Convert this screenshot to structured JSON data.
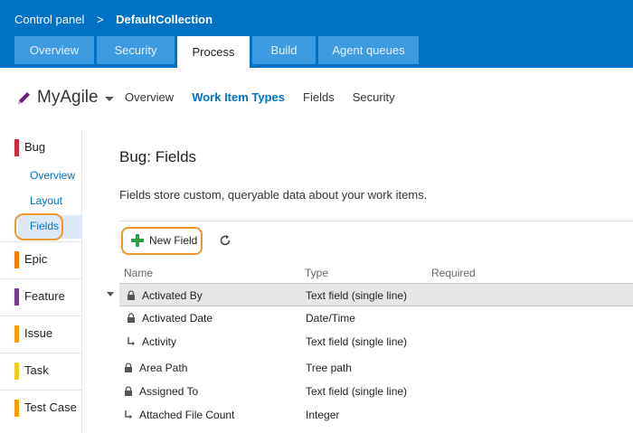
{
  "breadcrumb": {
    "root": "Control panel",
    "separator": ">",
    "current": "DefaultCollection"
  },
  "tabs": [
    "Overview",
    "Security",
    "Process",
    "Build",
    "Agent queues"
  ],
  "process": {
    "name": "MyAgile"
  },
  "subnav": [
    "Overview",
    "Work Item Types",
    "Fields",
    "Security"
  ],
  "sidebar": {
    "bug": {
      "label": "Bug",
      "color": "#cc293d"
    },
    "bug_sub": [
      "Overview",
      "Layout",
      "Fields"
    ],
    "types": [
      {
        "label": "Epic",
        "color": "#ff7b00"
      },
      {
        "label": "Feature",
        "color": "#773b93"
      },
      {
        "label": "Issue",
        "color": "#ff9d00"
      },
      {
        "label": "Task",
        "color": "#f2cb1d"
      },
      {
        "label": "Test Case",
        "color": "#ff9d00"
      }
    ]
  },
  "main": {
    "title": "Bug: Fields",
    "description": "Fields store custom, queryable data about your work items.",
    "new_field_label": "New Field",
    "columns": [
      "Name",
      "Type",
      "Required"
    ],
    "rows": [
      {
        "name": "Activated By",
        "type": "Text field (single line)",
        "icon": "lock-icon"
      },
      {
        "name": "Activated Date",
        "type": "Date/Time",
        "icon": "lock-icon"
      },
      {
        "name": "Activity",
        "type": "Text field (single line)",
        "icon": "inherited-icon"
      },
      {
        "name": "Area Path",
        "type": "Tree path",
        "icon": "lock-icon"
      },
      {
        "name": "Assigned To",
        "type": "Text field (single line)",
        "icon": "lock-icon"
      },
      {
        "name": "Attached File Count",
        "type": "Integer",
        "icon": "inherited-icon"
      }
    ]
  }
}
